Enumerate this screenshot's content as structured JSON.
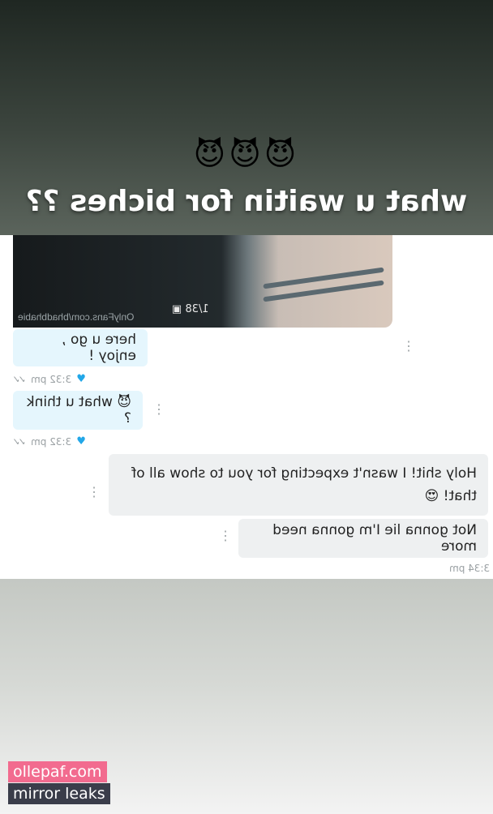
{
  "story": {
    "emojis": "😈😈😈",
    "caption": "what u waitin for biches ??"
  },
  "media": {
    "count": "1/38 ▣",
    "watermark": "OnlyFans.com/bhadbhabie"
  },
  "messages": [
    {
      "text": "here u go , enjoy !",
      "direction": "in"
    },
    {
      "text": "😈 what u think ?",
      "direction": "in"
    },
    {
      "text": "Holy shit! I wasn't expecting for you to show all of that! 😍",
      "direction": "out"
    },
    {
      "text": "Not gonna lie I'm gonna need more",
      "direction": "out"
    }
  ],
  "meta": [
    {
      "time": "3:32 pm"
    },
    {
      "time": "3:32 pm"
    },
    {
      "time": "3:34 pm"
    }
  ],
  "watermark": {
    "line1": "ollepaf.com",
    "line2": "mirror leaks"
  },
  "colors": {
    "incoming_bubble": "#e5f6fd",
    "outgoing_bubble": "#eef0f1",
    "heart": "#22a7e8",
    "badge_pink": "#f26b8f",
    "badge_dark": "#3a3d4a"
  }
}
